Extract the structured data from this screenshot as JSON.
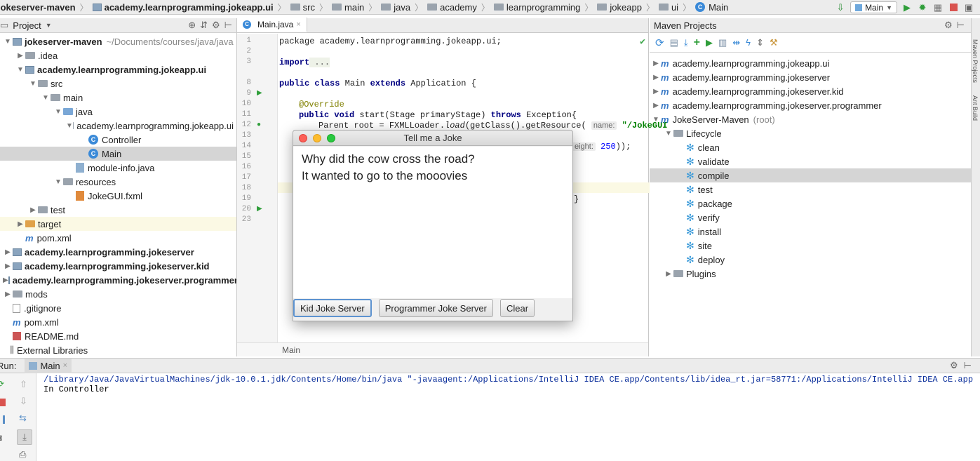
{
  "nav": {
    "crumbs": [
      "jokeserver-maven",
      "academy.learnprogramming.jokeapp.ui",
      "src",
      "main",
      "java",
      "academy",
      "learnprogramming",
      "jokeapp",
      "ui",
      "Main"
    ],
    "run_config": "Main"
  },
  "project": {
    "header": "Project",
    "tree": [
      {
        "indent": 0,
        "arrow": "▼",
        "icon": "module",
        "label": "jokeserver-maven",
        "bold": true,
        "suffix": "~/Documents/courses/java/java"
      },
      {
        "indent": 1,
        "arrow": "▶",
        "icon": "folder",
        "label": ".idea"
      },
      {
        "indent": 1,
        "arrow": "▼",
        "icon": "module",
        "label": "academy.learnprogramming.jokeapp.ui",
        "bold": true
      },
      {
        "indent": 2,
        "arrow": "▼",
        "icon": "folder",
        "label": "src"
      },
      {
        "indent": 3,
        "arrow": "▼",
        "icon": "folder",
        "label": "main"
      },
      {
        "indent": 4,
        "arrow": "▼",
        "icon": "folder-blue",
        "label": "java"
      },
      {
        "indent": 5,
        "arrow": "▼",
        "icon": "package",
        "label": "academy.learnprogramming.jokeapp.ui"
      },
      {
        "indent": 6,
        "arrow": "",
        "icon": "class",
        "label": "Controller"
      },
      {
        "indent": 6,
        "arrow": "",
        "icon": "class",
        "label": "Main",
        "selected": true
      },
      {
        "indent": 5,
        "arrow": "",
        "icon": "java-file",
        "label": "module-info.java"
      },
      {
        "indent": 4,
        "arrow": "▼",
        "icon": "folder",
        "label": "resources"
      },
      {
        "indent": 5,
        "arrow": "",
        "icon": "fxml",
        "label": "JokeGUI.fxml"
      },
      {
        "indent": 2,
        "arrow": "▶",
        "icon": "folder",
        "label": "test"
      },
      {
        "indent": 1,
        "arrow": "▶",
        "icon": "folder-orange",
        "label": "target",
        "highlight": true
      },
      {
        "indent": 1,
        "arrow": "",
        "icon": "maven",
        "label": "pom.xml"
      },
      {
        "indent": 0,
        "arrow": "▶",
        "icon": "module",
        "label": "academy.learnprogramming.jokeserver",
        "bold": true
      },
      {
        "indent": 0,
        "arrow": "▶",
        "icon": "module",
        "label": "academy.learnprogramming.jokeserver.kid",
        "bold": true
      },
      {
        "indent": 0,
        "arrow": "▶",
        "icon": "module",
        "label": "academy.learnprogramming.jokeserver.programmer",
        "bold": true
      },
      {
        "indent": 0,
        "arrow": "▶",
        "icon": "folder",
        "label": "mods"
      },
      {
        "indent": 0,
        "arrow": "",
        "icon": "file",
        "label": ".gitignore"
      },
      {
        "indent": 0,
        "arrow": "",
        "icon": "maven",
        "label": "pom.xml"
      },
      {
        "indent": 0,
        "arrow": "",
        "icon": "md",
        "label": "README.md"
      },
      {
        "indent": -1,
        "arrow": "",
        "icon": "libs",
        "label": "External Libraries"
      }
    ]
  },
  "editor": {
    "tab": "Main.java",
    "line_numbers": [
      "1",
      "2",
      "3",
      "8",
      "9",
      "10",
      "11",
      "12",
      "13",
      "14",
      "15",
      "16",
      "17",
      "18",
      "19",
      "20",
      "23"
    ],
    "code": {
      "l1": "package academy.learnprogramming.jokeapp.ui;",
      "l3_kw": "import",
      "l3_rest": " ...",
      "l9_a": "public class",
      "l9_b": " Main ",
      "l9_c": "extends",
      "l9_d": " Application {",
      "l11": "@Override",
      "l12_kw": "public void",
      "l12_rest": " start(Stage primaryStage) ",
      "l12_kw2": "throws",
      "l12_end": " Exception{",
      "l13_a": "Parent root = FXMLLoader.",
      "l13_b": "load",
      "l13_c": "(getClass().getResource(",
      "l13_hint": "name:",
      "l13_str": "\"/JokeGUI",
      "l15_hint": "eight:",
      "l15_num": "250",
      "l15_end": "));",
      "l20": "}"
    },
    "breadcrumb": "Main"
  },
  "dialog": {
    "title": "Tell me a Joke",
    "line1": "Why did the cow cross the road?",
    "line2": "It wanted to go to the mooovies",
    "buttons": {
      "kid": "Kid Joke Server",
      "programmer": "Programmer Joke Server",
      "clear": "Clear"
    }
  },
  "maven": {
    "header": "Maven Projects",
    "tree": [
      {
        "indent": 0,
        "arrow": "▶",
        "icon": "maven",
        "label": "academy.learnprogramming.jokeapp.ui"
      },
      {
        "indent": 0,
        "arrow": "▶",
        "icon": "maven",
        "label": "academy.learnprogramming.jokeserver"
      },
      {
        "indent": 0,
        "arrow": "▶",
        "icon": "maven",
        "label": "academy.learnprogramming.jokeserver.kid"
      },
      {
        "indent": 0,
        "arrow": "▶",
        "icon": "maven",
        "label": "academy.learnprogramming.jokeserver.programmer"
      },
      {
        "indent": 0,
        "arrow": "▼",
        "icon": "maven",
        "label": "JokeServer-Maven",
        "suffix": "(root)"
      },
      {
        "indent": 1,
        "arrow": "▼",
        "icon": "folder-gear",
        "label": "Lifecycle"
      },
      {
        "indent": 2,
        "arrow": "",
        "icon": "gear",
        "label": "clean"
      },
      {
        "indent": 2,
        "arrow": "",
        "icon": "gear",
        "label": "validate"
      },
      {
        "indent": 2,
        "arrow": "",
        "icon": "gear",
        "label": "compile",
        "selected": true
      },
      {
        "indent": 2,
        "arrow": "",
        "icon": "gear",
        "label": "test"
      },
      {
        "indent": 2,
        "arrow": "",
        "icon": "gear",
        "label": "package"
      },
      {
        "indent": 2,
        "arrow": "",
        "icon": "gear",
        "label": "verify"
      },
      {
        "indent": 2,
        "arrow": "",
        "icon": "gear",
        "label": "install"
      },
      {
        "indent": 2,
        "arrow": "",
        "icon": "gear",
        "label": "site"
      },
      {
        "indent": 2,
        "arrow": "",
        "icon": "gear",
        "label": "deploy"
      },
      {
        "indent": 1,
        "arrow": "▶",
        "icon": "folder-gear",
        "label": "Plugins"
      }
    ]
  },
  "run": {
    "label": "Run:",
    "tab": "Main",
    "console_line1": "/Library/Java/JavaVirtualMachines/jdk-10.0.1.jdk/Contents/Home/bin/java \"-javaagent:/Applications/IntelliJ IDEA CE.app/Contents/lib/idea_rt.jar=58771:/Applications/IntelliJ IDEA CE.app/Cont",
    "console_line2": "In Controller"
  },
  "right_strip": {
    "maven_projects": "Maven Projects",
    "ant_build": "Ant Build"
  }
}
